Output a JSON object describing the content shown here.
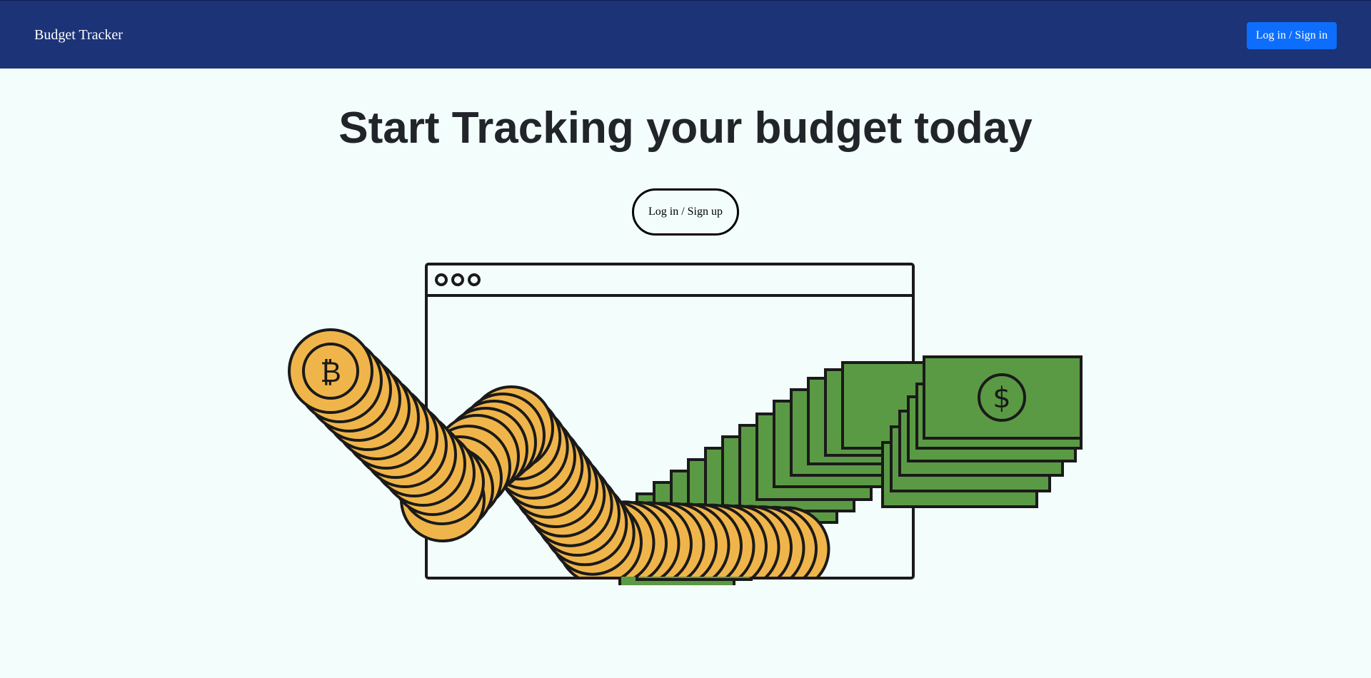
{
  "navbar": {
    "brand": "Budget Tracker",
    "login_label": "Log in / Sign in",
    "background_color": "#1c3378",
    "button_color": "#0d6efd"
  },
  "hero": {
    "headline": "Start Tracking your budget today",
    "cta_label": "Log in / Sign up"
  },
  "illustration": {
    "coin_symbol": "₿",
    "bill_symbol": "$",
    "coin_color": "#f0b54a",
    "bill_color": "#5b9a44"
  }
}
